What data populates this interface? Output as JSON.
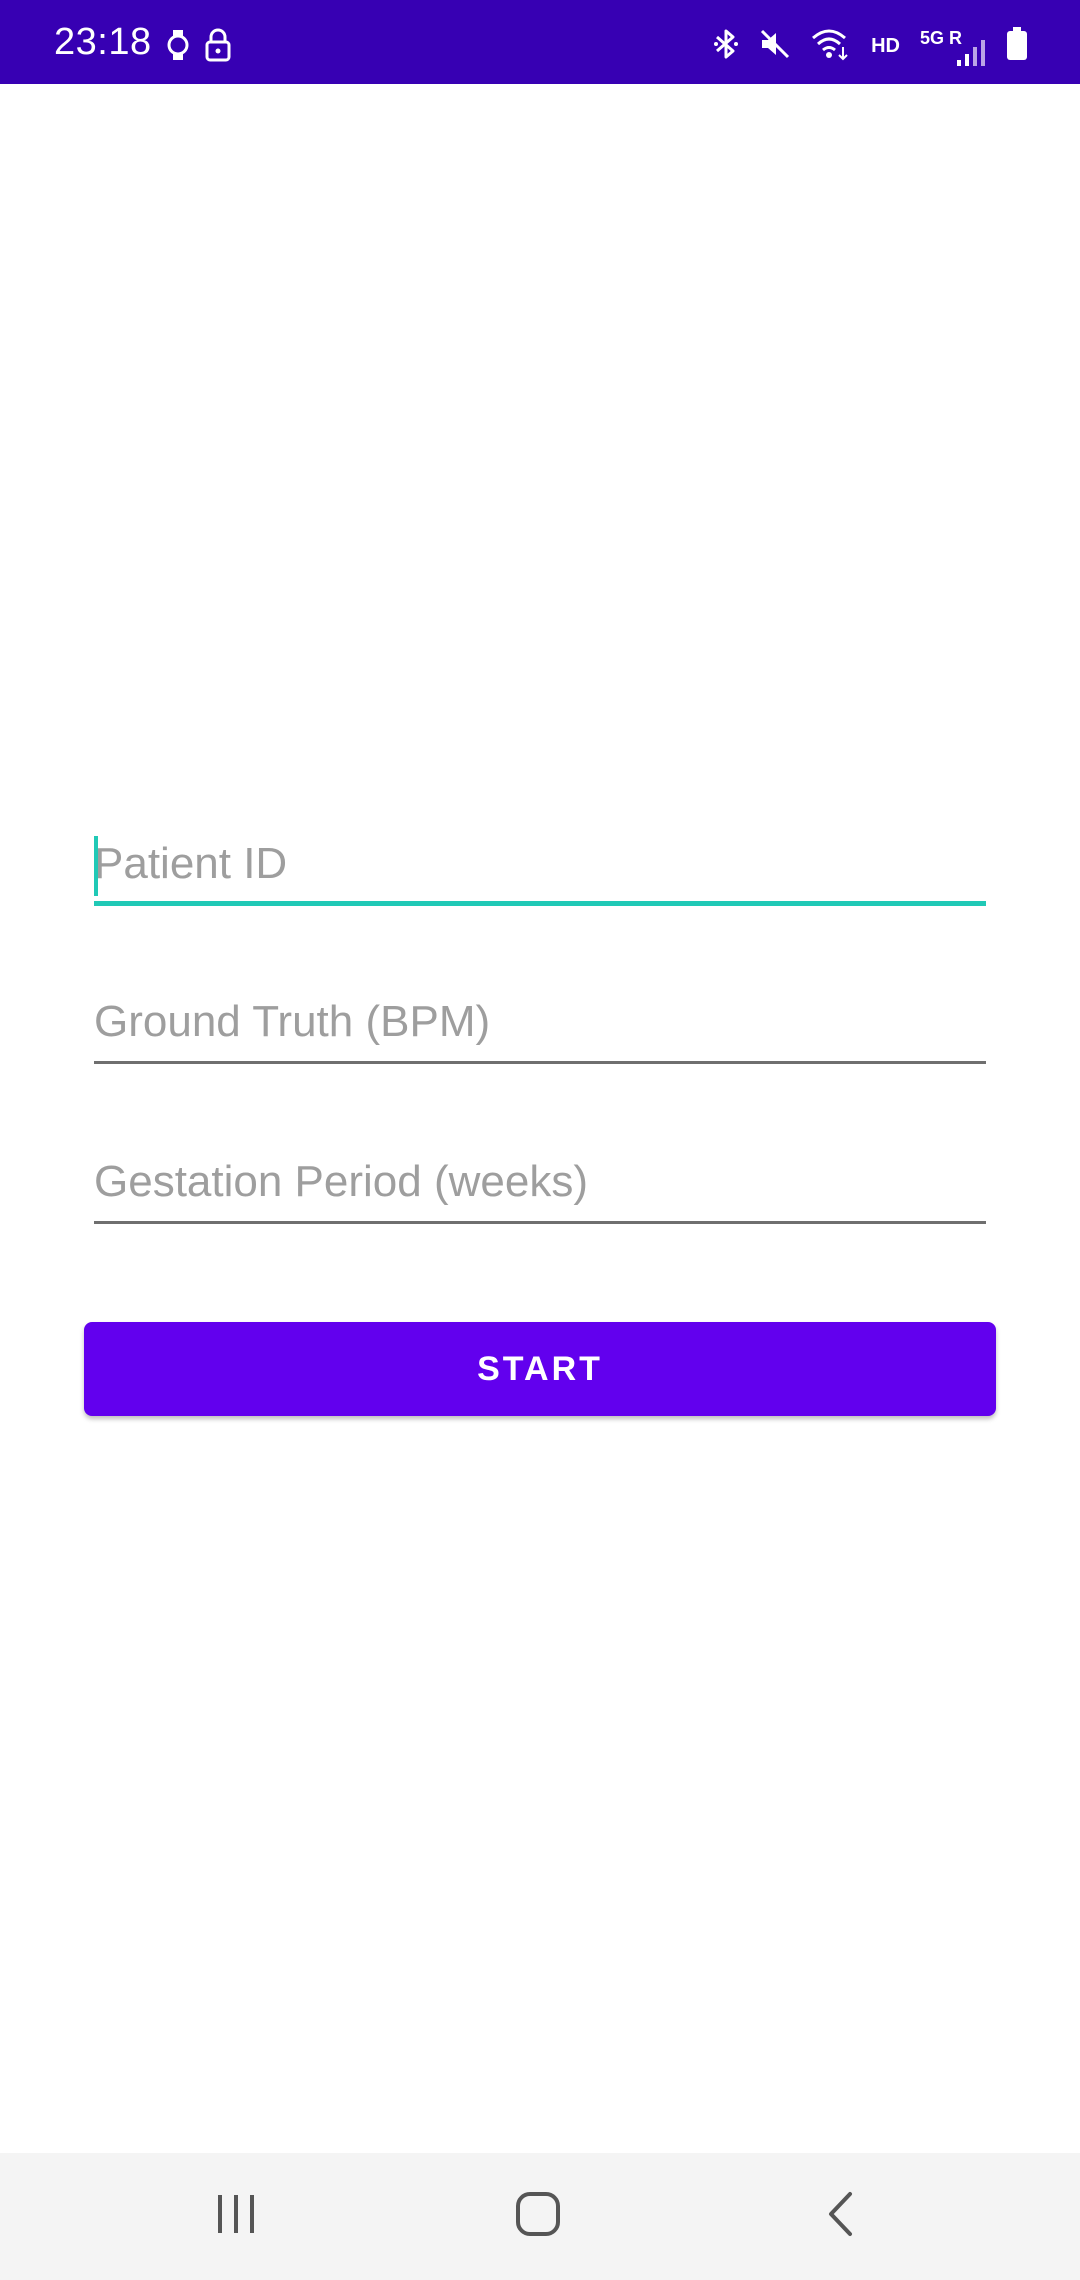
{
  "status_bar": {
    "time": "23:18",
    "hd_label": "HD",
    "network_label": "5G R",
    "background": "#3700B3",
    "left_icons": [
      "watch-icon",
      "lock-icon"
    ],
    "right_icons": [
      "bluetooth-icon",
      "mute-icon",
      "wifi-icon",
      "signal-icon",
      "battery-icon"
    ]
  },
  "form": {
    "patient_id": {
      "placeholder": "Patient ID",
      "value": ""
    },
    "ground_truth": {
      "placeholder": "Ground Truth (BPM)",
      "value": ""
    },
    "gestation_period": {
      "placeholder": "Gestation Period (weeks)",
      "value": ""
    },
    "start_label": "START"
  },
  "colors": {
    "accent": "#6200EE",
    "focus": "#20C9B6"
  },
  "nav_bar": {
    "buttons": [
      "recents-icon",
      "home-icon",
      "back-icon"
    ]
  }
}
